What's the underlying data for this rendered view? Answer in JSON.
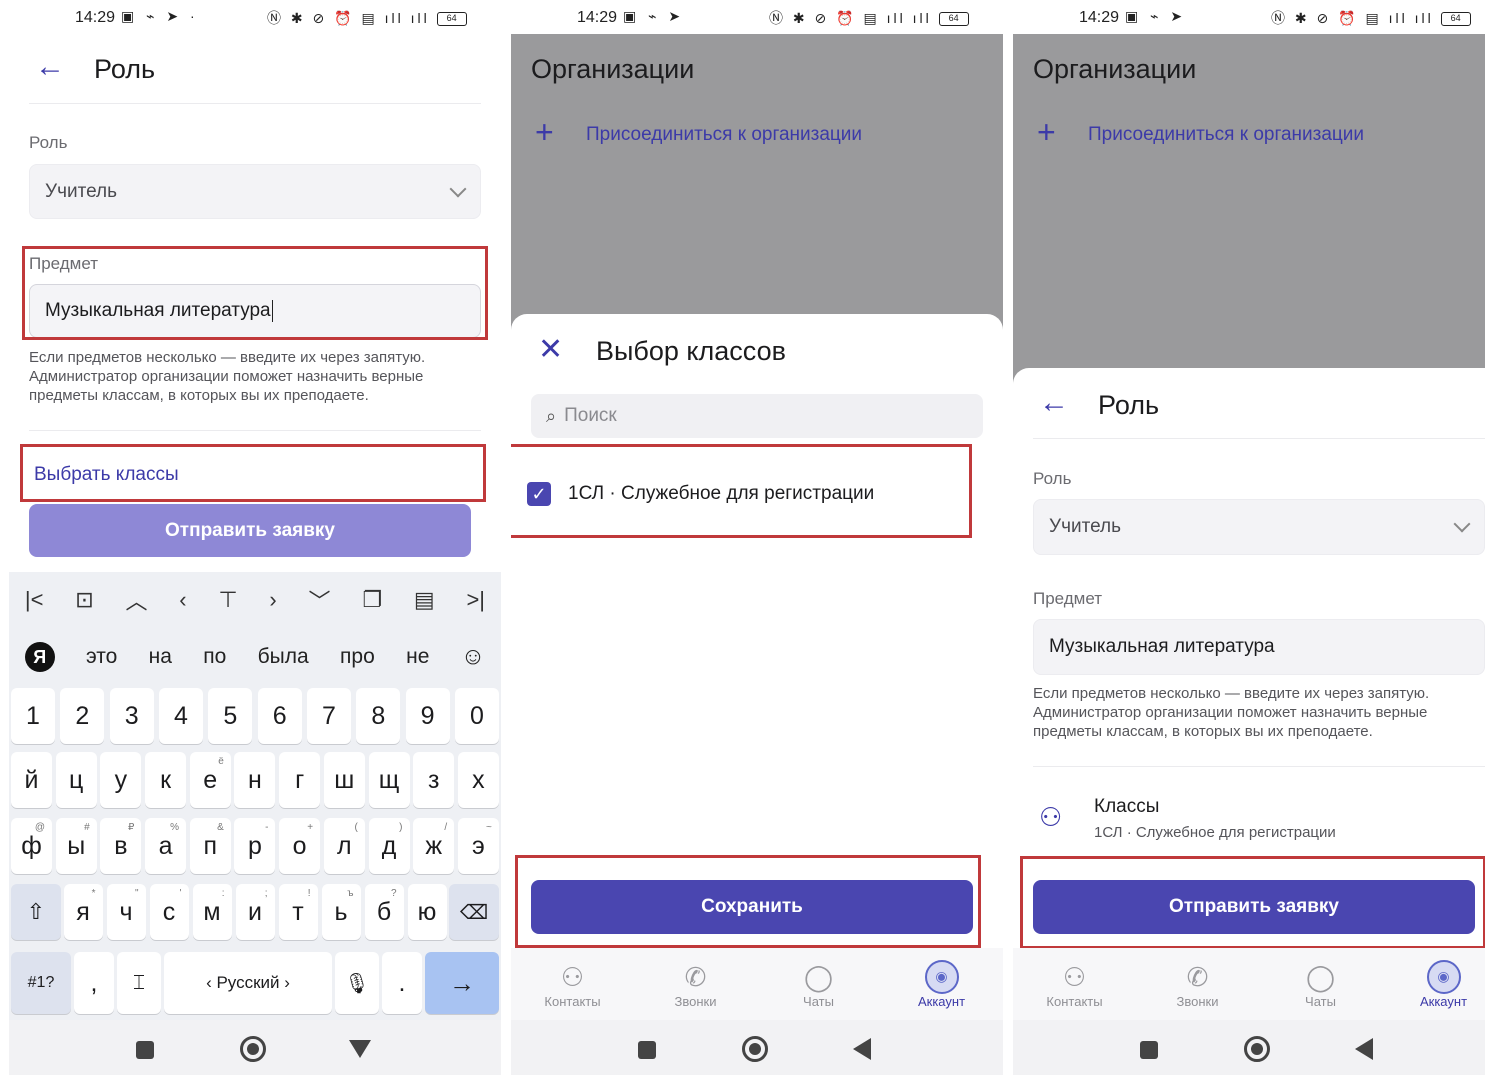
{
  "status": {
    "time": "14:29",
    "battery": "64"
  },
  "screen1": {
    "title": "Роль",
    "role_label": "Роль",
    "role_value": "Учитель",
    "subject_label": "Предмет",
    "subject_value": "Музыкальная литература",
    "hint": "Если предметов несколько — введите их через запятую. Администратор организации поможет назначить верные предметы классам, в которых вы их преподаете.",
    "choose_classes": "Выбрать классы",
    "submit": "Отправить заявку",
    "keyboard": {
      "suggestions": [
        "это",
        "на",
        "по",
        "была",
        "про",
        "не"
      ],
      "digits": [
        "1",
        "2",
        "3",
        "4",
        "5",
        "6",
        "7",
        "8",
        "9",
        "0"
      ],
      "row1": [
        "й",
        "ц",
        "у",
        "к",
        "е",
        "н",
        "г",
        "ш",
        "щ",
        "з",
        "х"
      ],
      "row2": [
        "ф",
        "ы",
        "в",
        "а",
        "п",
        "р",
        "о",
        "л",
        "д",
        "ж",
        "э"
      ],
      "row3": [
        "я",
        "ч",
        "с",
        "м",
        "и",
        "т",
        "ь",
        "б",
        "ю"
      ],
      "row2_sup": [
        "@",
        "#",
        "₽",
        "%",
        "&",
        "-",
        "+",
        "(",
        ")",
        "/",
        "~"
      ],
      "row1_sup_e": "ё",
      "row3_sup": [
        "*",
        "\"",
        "'",
        ":",
        ";",
        "!",
        "ъ",
        "?",
        ""
      ],
      "symbols": "#1?",
      "comma": ",",
      "language": "‹ Русский ›",
      "period": "."
    }
  },
  "screen2": {
    "bg_title": "Организации",
    "join": "Присоединиться к организации",
    "sheet_title": "Выбор классов",
    "search_placeholder": "Поиск",
    "class_item": "1СЛ · Служебное для регистрации",
    "save": "Сохранить"
  },
  "screen3": {
    "bg_title": "Организации",
    "join": "Присоединиться к организации",
    "title": "Роль",
    "role_label": "Роль",
    "role_value": "Учитель",
    "subject_label": "Предмет",
    "subject_value": "Музыкальная литература",
    "hint": "Если предметов несколько — введите их через запятую. Администратор организации поможет назначить верные предметы классам, в которых вы их преподаете.",
    "classes_title": "Классы",
    "classes_value": "1СЛ · Служебное для регистрации",
    "submit": "Отправить заявку"
  },
  "tabs": [
    {
      "label": "Контакты",
      "icon": "contacts-icon"
    },
    {
      "label": "Звонки",
      "icon": "phone-icon"
    },
    {
      "label": "Чаты",
      "icon": "chat-icon"
    },
    {
      "label": "Аккаунт",
      "icon": "account-icon"
    }
  ],
  "colors": {
    "accent": "#4a46b0",
    "accent_faded": "#8e88d6",
    "highlight": "#c0393b",
    "overlay": "#9a9a9c"
  }
}
